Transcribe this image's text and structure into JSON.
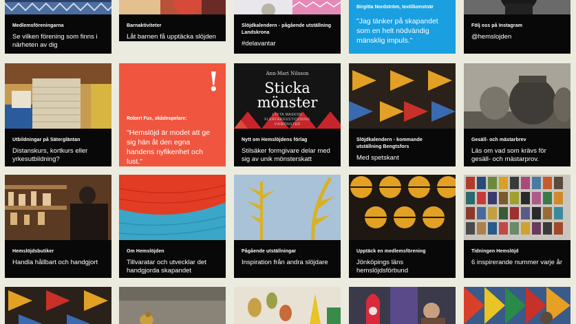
{
  "row1": [
    {
      "category": "Medlemsföreningarna",
      "title": "Se vilken förening som finns i närheten av dig"
    },
    {
      "category": "Barnaktiviteter",
      "title": "Låt barnen få upptäcka slöjden"
    },
    {
      "category": "Slöjdkalendern - pågående utställning Landskrona",
      "title": "#delavantar"
    },
    {
      "category": "Birgitta Nordström, textilkonstnär",
      "quote": "\"Jag tänker på skapandet som en helt nödvändig mänsklig impuls.\""
    },
    {
      "category": "Följ oss på Instagram",
      "title": "@hemslojden"
    }
  ],
  "row2": [
    {
      "category": "Utbildningar på Sätergläntan",
      "title": "Distanskurs, kortkurs eller yrkesutbildning?"
    },
    {
      "category": "Robert Fux, skådespelare:",
      "quote": "\"Hemslöjd är modet att ge sig hän åt den egna handens nyfikenhet och lust.\"",
      "mark": "!"
    },
    {
      "category": "Nytt om Hemslöjdens förlag",
      "title": "Stilsäker formgivare delar med sig av unik mönsterskatt",
      "book": {
        "author": "Ann-Mari Nilsson",
        "title_line1": "Sticka",
        "title_line2": "mönster",
        "subtitle_line1": "LYFTA MASKOR",
        "subtitle_line2": "FLERFÄRGSSTICKNING",
        "subtitle_line3": "VIKMÖNSTER"
      }
    },
    {
      "category": "Slöjdkalendern - kommande utställning Bengtsfors",
      "title": "Med spetskant"
    },
    {
      "category": "Gesäll- och mästarbrev",
      "title": "Läs om vad som krävs för gesäll- och mästarprov."
    }
  ],
  "row3": [
    {
      "category": "Hemslöjdsbutiker",
      "title": "Handla hållbart och handgjort"
    },
    {
      "category": "Om Hemslöjden",
      "title": "Tillvaratar och utvecklar det handgjorda skapandet"
    },
    {
      "category": "Pågående utställningar",
      "title": "Inspiration från andra slöjdare"
    },
    {
      "category": "Upptäck en medlemsförening",
      "title": "Jönköpings läns hemslöjdsförbund"
    },
    {
      "category": "Tidningen Hemslöjd",
      "title": "6 inspirerande nummer varje år"
    }
  ],
  "colors": {
    "background": "#ecebdf",
    "caption_bg": "#080808",
    "quote_blue": "#1a9fe0",
    "quote_red": "#f0563f"
  }
}
